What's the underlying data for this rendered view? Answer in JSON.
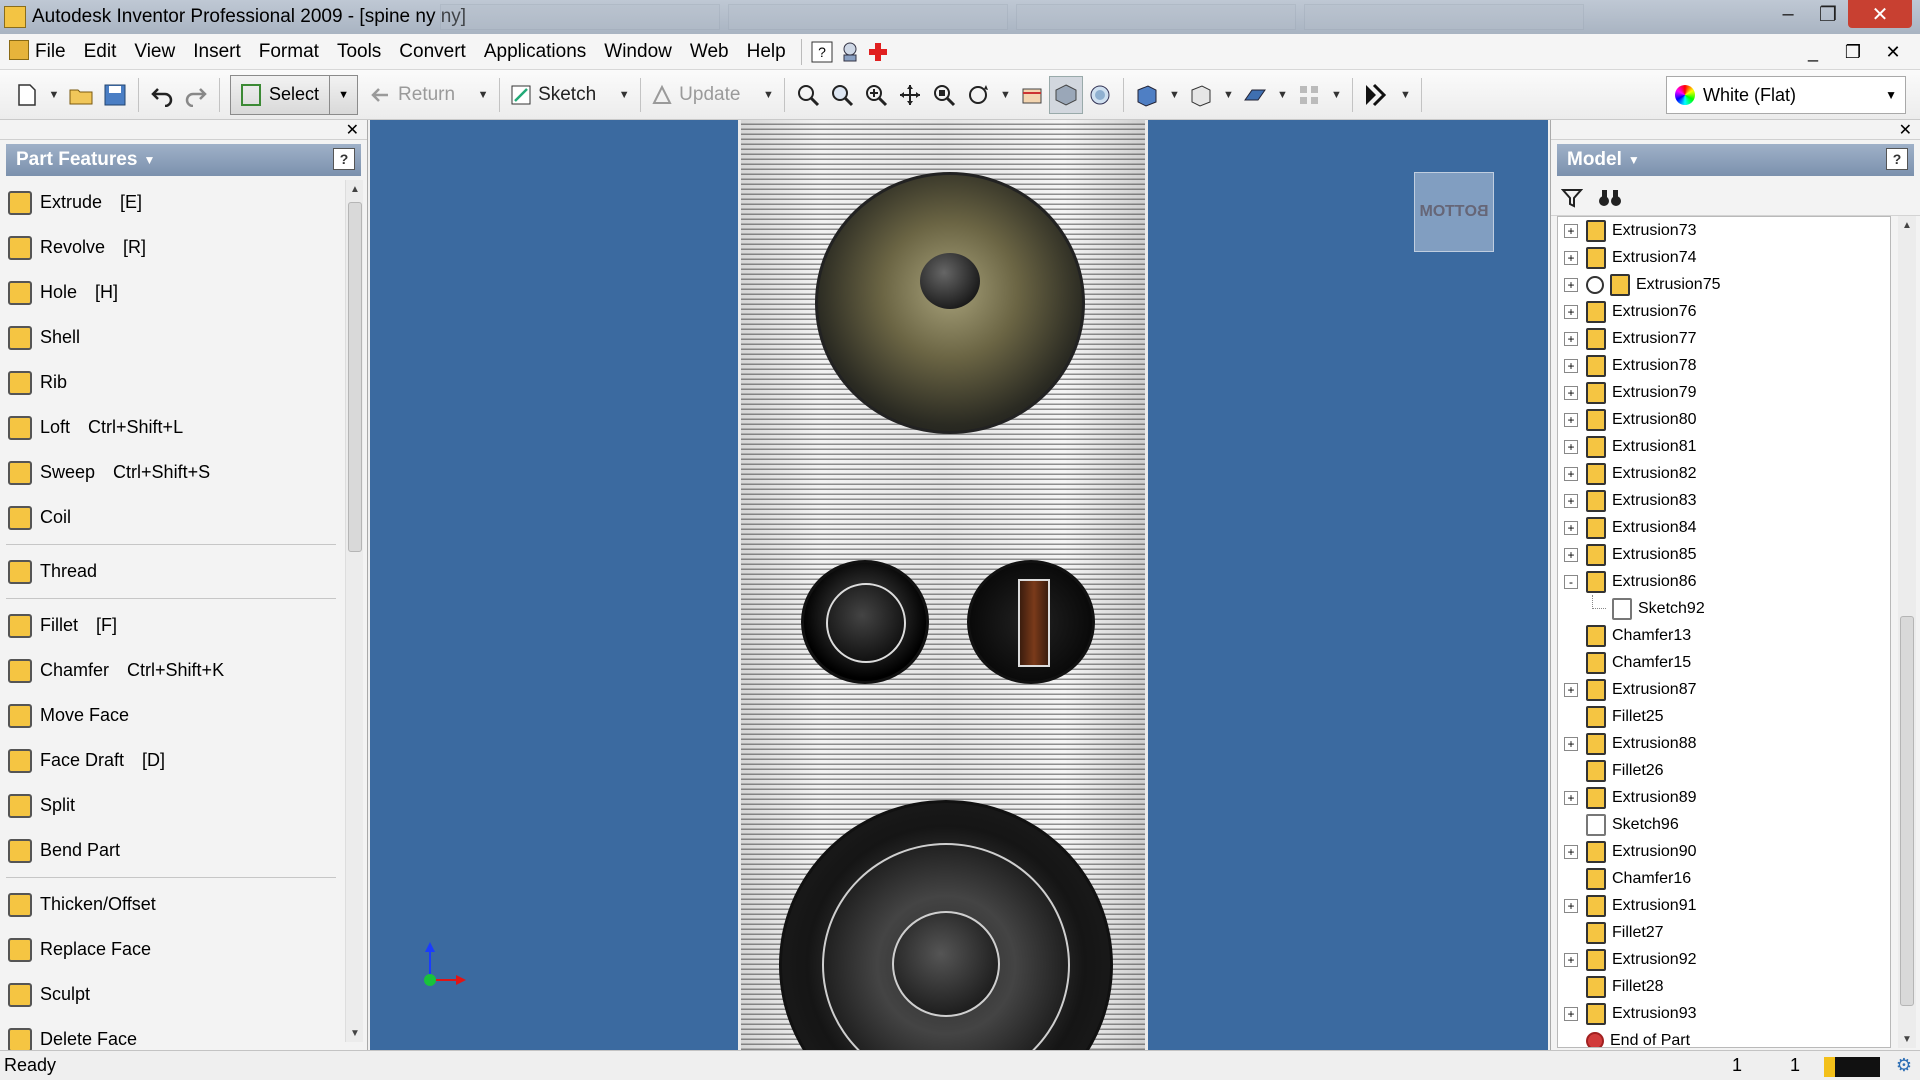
{
  "window": {
    "title": "Autodesk Inventor Professional 2009 - [spine ny ny]",
    "controls": {
      "minimize": "–",
      "maximize": "❐",
      "close": "✕"
    }
  },
  "menubar": {
    "items": [
      "File",
      "Edit",
      "View",
      "Insert",
      "Format",
      "Tools",
      "Convert",
      "Applications",
      "Window",
      "Web",
      "Help"
    ],
    "mdi_controls": {
      "minimize": "_",
      "restore": "❐",
      "close": "✕"
    }
  },
  "toolbar": {
    "select_label": "Select",
    "return_label": "Return",
    "sketch_label": "Sketch",
    "update_label": "Update",
    "style_value": "White (Flat)"
  },
  "left_panel": {
    "title": "Part Features",
    "features": [
      {
        "label": "Extrude",
        "shortcut": "[E]"
      },
      {
        "label": "Revolve",
        "shortcut": "[R]"
      },
      {
        "label": "Hole",
        "shortcut": "[H]"
      },
      {
        "label": "Shell",
        "shortcut": ""
      },
      {
        "label": "Rib",
        "shortcut": ""
      },
      {
        "label": "Loft",
        "shortcut": "Ctrl+Shift+L"
      },
      {
        "label": "Sweep",
        "shortcut": "Ctrl+Shift+S"
      },
      {
        "label": "Coil",
        "shortcut": ""
      },
      {
        "label": "Thread",
        "shortcut": ""
      },
      {
        "label": "Fillet",
        "shortcut": "[F]"
      },
      {
        "label": "Chamfer",
        "shortcut": "Ctrl+Shift+K"
      },
      {
        "label": "Move Face",
        "shortcut": ""
      },
      {
        "label": "Face Draft",
        "shortcut": "[D]"
      },
      {
        "label": "Split",
        "shortcut": ""
      },
      {
        "label": "Bend Part",
        "shortcut": ""
      },
      {
        "label": "Thicken/Offset",
        "shortcut": ""
      },
      {
        "label": "Replace Face",
        "shortcut": ""
      },
      {
        "label": "Sculpt",
        "shortcut": ""
      },
      {
        "label": "Delete Face",
        "shortcut": ""
      }
    ]
  },
  "viewport": {
    "viewcube_label": "BOTTOM",
    "background_color": "#3b6aa0"
  },
  "right_panel": {
    "title": "Model",
    "tree": [
      {
        "label": "Extrusion73",
        "expander": "+",
        "icon": "extrusion"
      },
      {
        "label": "Extrusion74",
        "expander": "+",
        "icon": "extrusion"
      },
      {
        "label": "Extrusion75",
        "expander": "+",
        "icon": "extrusion-info"
      },
      {
        "label": "Extrusion76",
        "expander": "+",
        "icon": "extrusion"
      },
      {
        "label": "Extrusion77",
        "expander": "+",
        "icon": "extrusion"
      },
      {
        "label": "Extrusion78",
        "expander": "+",
        "icon": "extrusion"
      },
      {
        "label": "Extrusion79",
        "expander": "+",
        "icon": "extrusion"
      },
      {
        "label": "Extrusion80",
        "expander": "+",
        "icon": "extrusion"
      },
      {
        "label": "Extrusion81",
        "expander": "+",
        "icon": "extrusion"
      },
      {
        "label": "Extrusion82",
        "expander": "+",
        "icon": "extrusion"
      },
      {
        "label": "Extrusion83",
        "expander": "+",
        "icon": "extrusion"
      },
      {
        "label": "Extrusion84",
        "expander": "+",
        "icon": "extrusion"
      },
      {
        "label": "Extrusion85",
        "expander": "+",
        "icon": "extrusion"
      },
      {
        "label": "Extrusion86",
        "expander": "-",
        "icon": "extrusion"
      },
      {
        "label": "Sketch92",
        "expander": "",
        "icon": "sketch",
        "child": true
      },
      {
        "label": "Chamfer13",
        "expander": "",
        "icon": "chamfer"
      },
      {
        "label": "Chamfer15",
        "expander": "",
        "icon": "chamfer"
      },
      {
        "label": "Extrusion87",
        "expander": "+",
        "icon": "extrusion"
      },
      {
        "label": "Fillet25",
        "expander": "",
        "icon": "fillet"
      },
      {
        "label": "Extrusion88",
        "expander": "+",
        "icon": "extrusion"
      },
      {
        "label": "Fillet26",
        "expander": "",
        "icon": "fillet"
      },
      {
        "label": "Extrusion89",
        "expander": "+",
        "icon": "extrusion"
      },
      {
        "label": "Sketch96",
        "expander": "",
        "icon": "sketch"
      },
      {
        "label": "Extrusion90",
        "expander": "+",
        "icon": "extrusion"
      },
      {
        "label": "Chamfer16",
        "expander": "",
        "icon": "chamfer"
      },
      {
        "label": "Extrusion91",
        "expander": "+",
        "icon": "extrusion"
      },
      {
        "label": "Fillet27",
        "expander": "",
        "icon": "fillet"
      },
      {
        "label": "Extrusion92",
        "expander": "+",
        "icon": "extrusion"
      },
      {
        "label": "Fillet28",
        "expander": "",
        "icon": "fillet"
      },
      {
        "label": "Extrusion93",
        "expander": "+",
        "icon": "extrusion"
      },
      {
        "label": "End of Part",
        "expander": "",
        "icon": "end-of-part"
      }
    ]
  },
  "statusbar": {
    "status": "Ready",
    "count_1": "1",
    "count_2": "1"
  }
}
